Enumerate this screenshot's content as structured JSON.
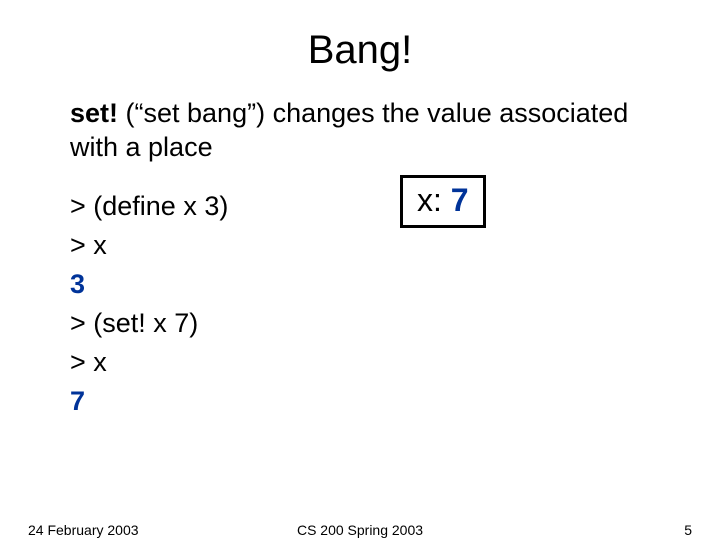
{
  "title": "Bang!",
  "desc": {
    "bold": "set!",
    "rest": " (“set bang”) changes the value associated with a place"
  },
  "repl": {
    "l1": "> (define x 3)",
    "l2": "> x",
    "l3": "3",
    "l4": "> (set! x 7)",
    "l5": "> x",
    "l6": "7"
  },
  "box": {
    "label": "x: ",
    "value": "7"
  },
  "footer": {
    "date": "24 February 2003",
    "course": "CS 200 Spring 2003",
    "page": "5"
  }
}
